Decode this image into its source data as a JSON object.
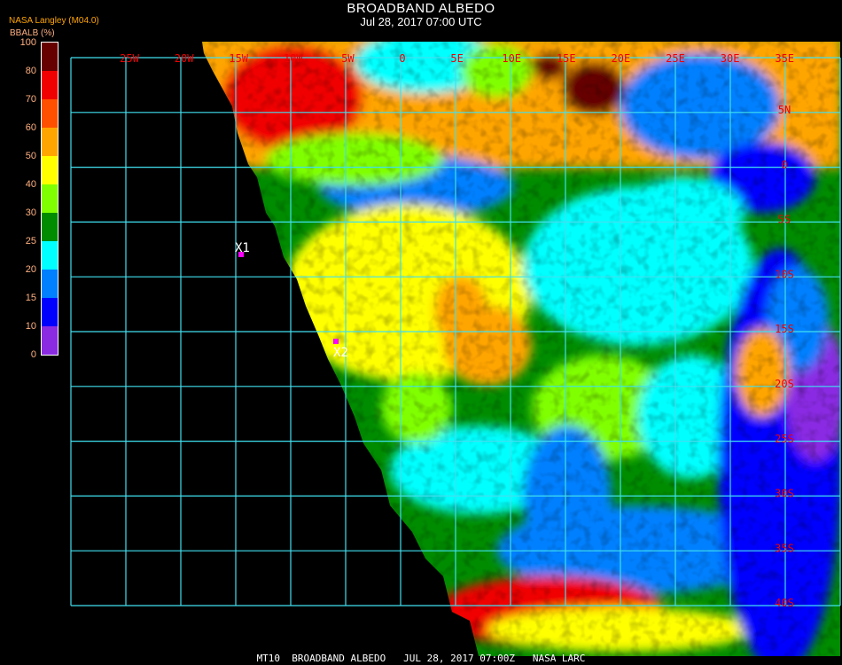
{
  "header": {
    "title": "BROADBAND ALBEDO",
    "subtitle": "Jul 28, 2017 07:00 UTC"
  },
  "legend": {
    "source": "NASA Langley (M04.0)",
    "unit_label": "BBALB (%)",
    "ticks": [
      "100",
      "80",
      "70",
      "60",
      "50",
      "40",
      "30",
      "25",
      "20",
      "15",
      "10",
      "0"
    ],
    "colors": [
      "#660000",
      "#f00000",
      "#ff5000",
      "#ffa500",
      "#ffff00",
      "#80ff00",
      "#008c00",
      "#00ffff",
      "#0080ff",
      "#0000ff",
      "#8a2be2"
    ]
  },
  "map": {
    "grid_color": "#40e0f0",
    "label_color": "#f00000",
    "lon_labels": [
      "25W",
      "20W",
      "15W",
      "10W",
      "5W",
      "0",
      "5E",
      "10E",
      "15E",
      "20E",
      "25E",
      "30E",
      "35E"
    ],
    "lat_labels": [
      "5N",
      "0",
      "5S",
      "10S",
      "15S",
      "20S",
      "25S",
      "30S",
      "35S",
      "40S"
    ],
    "markers": [
      {
        "label": "X1",
        "color": "#ff00ff"
      },
      {
        "label": "X2",
        "color": "#ff00ff"
      }
    ]
  },
  "footer": {
    "caption": "MT10  BROADBAND ALBEDO   JUL 28, 2017 07:00Z   NASA LARC"
  }
}
